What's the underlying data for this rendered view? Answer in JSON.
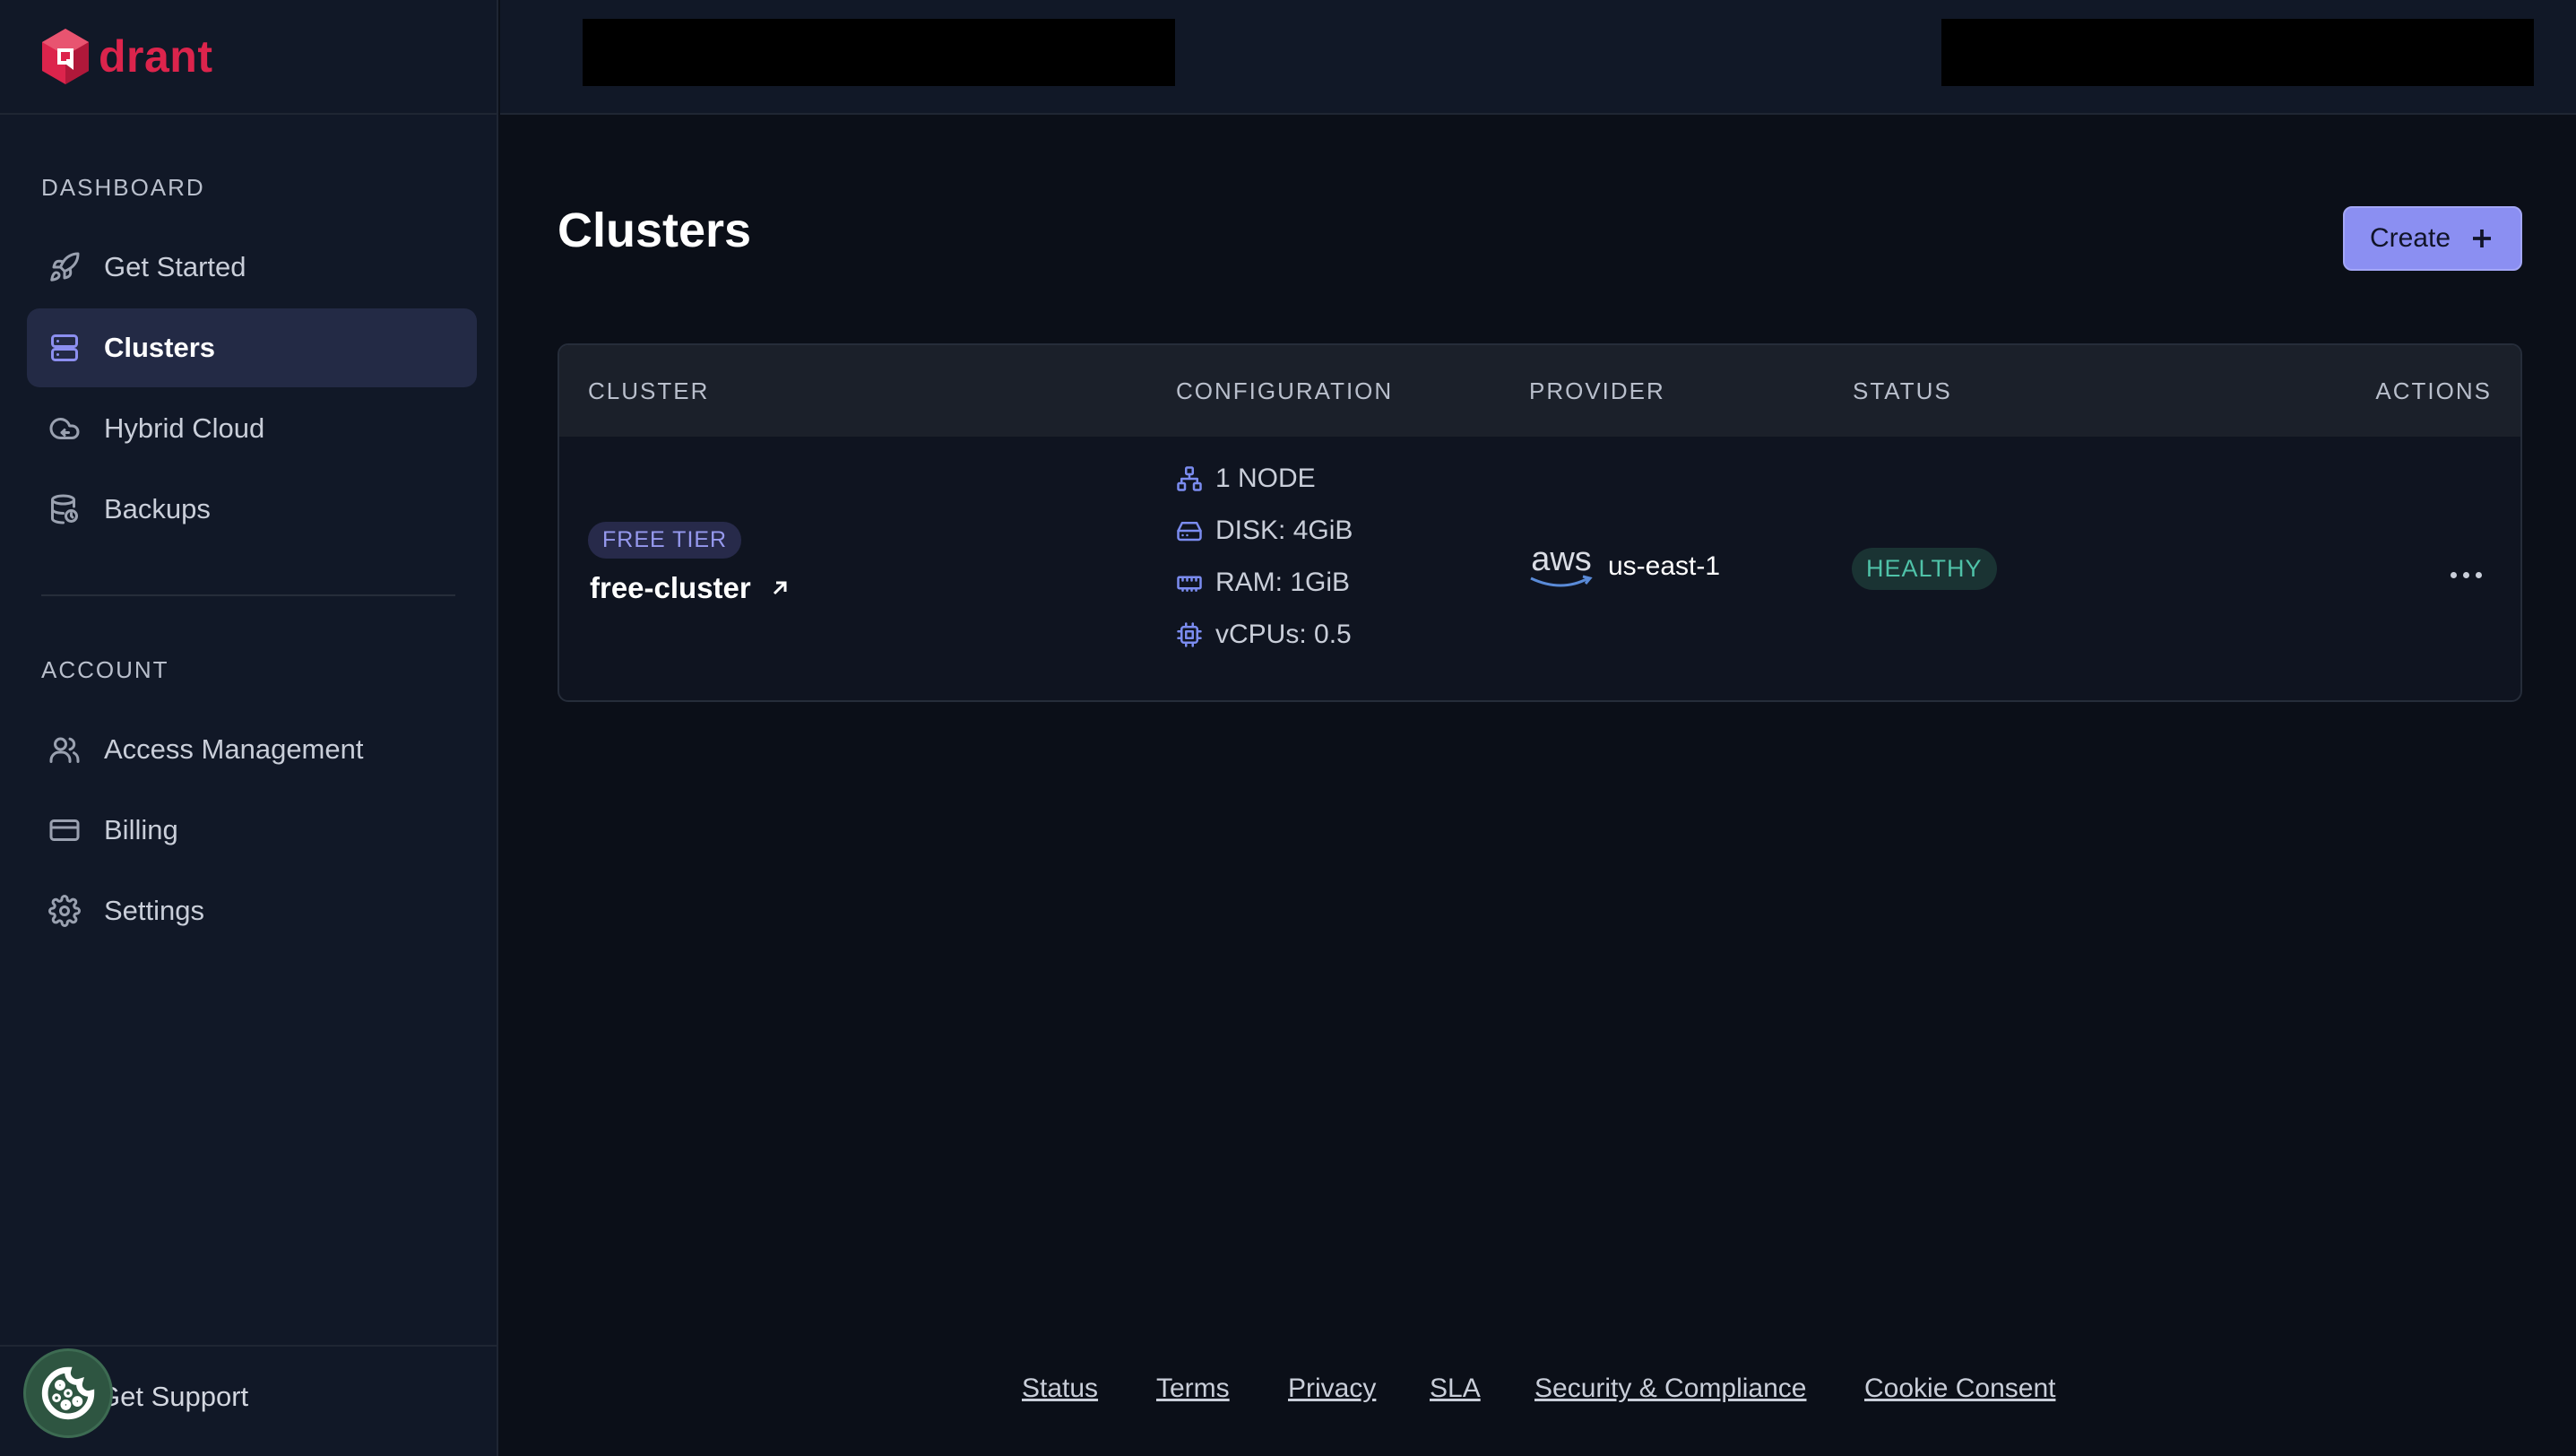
{
  "brand": {
    "logo_text": "drant",
    "logo_color": "#dc244c"
  },
  "sidebar": {
    "dashboard_label": "DASHBOARD",
    "dashboard_items": [
      {
        "label": "Get Started",
        "icon": "rocket-icon"
      },
      {
        "label": "Clusters",
        "icon": "server-icon",
        "active": true
      },
      {
        "label": "Hybrid Cloud",
        "icon": "cloud-sync-icon"
      },
      {
        "label": "Backups",
        "icon": "database-restore-icon"
      }
    ],
    "account_label": "ACCOUNT",
    "account_items": [
      {
        "label": "Access Management",
        "icon": "users-icon"
      },
      {
        "label": "Billing",
        "icon": "credit-card-icon"
      },
      {
        "label": "Settings",
        "icon": "gear-icon"
      }
    ],
    "support_label": "Get Support"
  },
  "main": {
    "title": "Clusters",
    "create_label": "Create",
    "table": {
      "headers": {
        "cluster": "CLUSTER",
        "configuration": "CONFIGURATION",
        "provider": "PROVIDER",
        "status": "STATUS",
        "actions": "ACTIONS"
      },
      "rows": [
        {
          "tier": "FREE TIER",
          "name": "free-cluster",
          "config": {
            "nodes": "1 NODE",
            "disk": "DISK: 4GiB",
            "ram": "RAM: 1GiB",
            "vcpus": "vCPUs: 0.5"
          },
          "provider_logo": "aws",
          "region": "us-east-1",
          "status": "HEALTHY"
        }
      ]
    }
  },
  "footer": {
    "links": [
      "Status",
      "Terms",
      "Privacy",
      "SLA",
      "Security & Compliance",
      "Cookie Consent"
    ]
  },
  "colors": {
    "accent": "#8b8ff2",
    "healthy": "#4fc2a8",
    "background": "#0b0f18",
    "sidebar": "#111827"
  }
}
